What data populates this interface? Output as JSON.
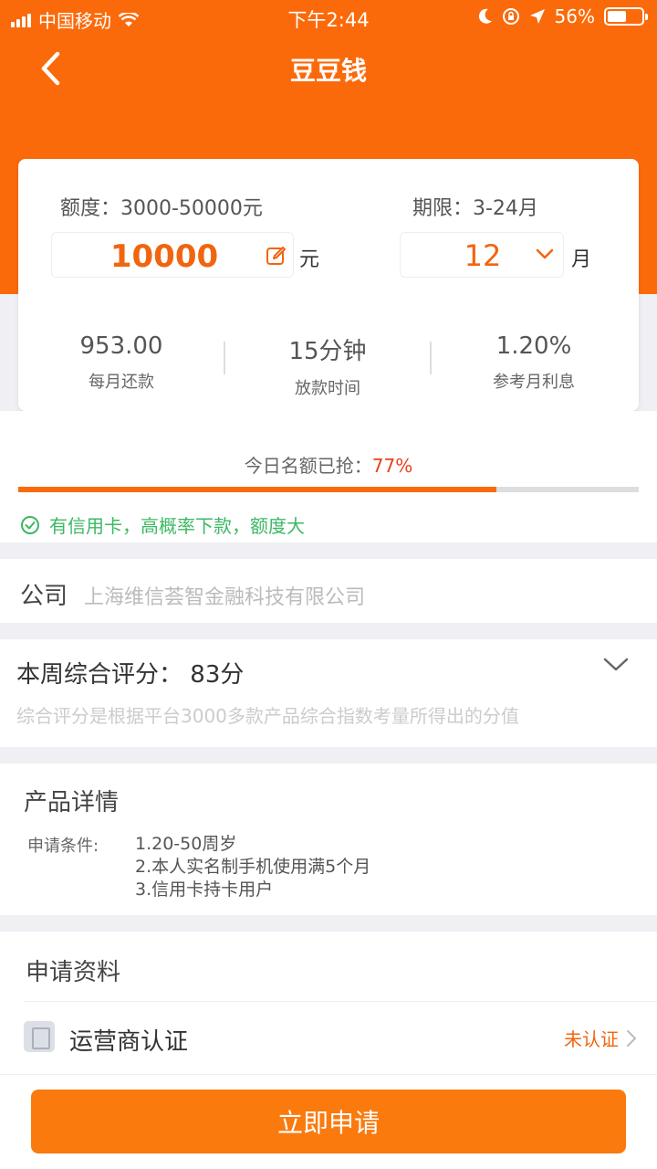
{
  "status_bar": {
    "carrier": "中国移动",
    "time": "下午2:44",
    "battery_pct": "56%",
    "battery_level": 0.56
  },
  "nav": {
    "title": "豆豆钱",
    "back_icon": "chevron-left-icon"
  },
  "loan_card": {
    "amount_range_label": "额度：3000-50000元",
    "amount_value": "10000",
    "amount_unit": "元",
    "term_range_label": "期限：3-24月",
    "term_value": "12",
    "term_unit": "月",
    "stats": [
      {
        "value": "953.00",
        "label": "每月还款"
      },
      {
        "value": "15分钟",
        "label": "放款时间"
      },
      {
        "value": "1.20%",
        "label": "参考月利息"
      }
    ]
  },
  "quota": {
    "label": "今日名额已抢：",
    "percent_text": "77%",
    "progress": 0.77
  },
  "tip": {
    "text": "有信用卡，高概率下款，额度大",
    "icon": "check-circle-icon"
  },
  "company": {
    "label": "公司",
    "value": "上海维信荟智金融科技有限公司"
  },
  "score": {
    "label": "本周综合评分：",
    "value": "83分",
    "description": "综合评分是根据平台3000多款产品综合指数考量所得出的分值"
  },
  "product_detail": {
    "title": "产品详情",
    "condition_label": "申请条件:",
    "conditions": [
      "1.20-50周岁",
      "2.本人实名制手机使用满5个月",
      "3.信用卡持卡用户"
    ]
  },
  "apply_materials": {
    "title": "申请资料",
    "items": [
      {
        "label": "运营商认证",
        "status": "未认证"
      }
    ]
  },
  "apply_button": {
    "label": "立即申请"
  },
  "colors": {
    "brand_orange": "#fb6a0a",
    "accent_text": "#f06510",
    "success_green": "#3cb864",
    "percent_red": "#e8421b"
  }
}
